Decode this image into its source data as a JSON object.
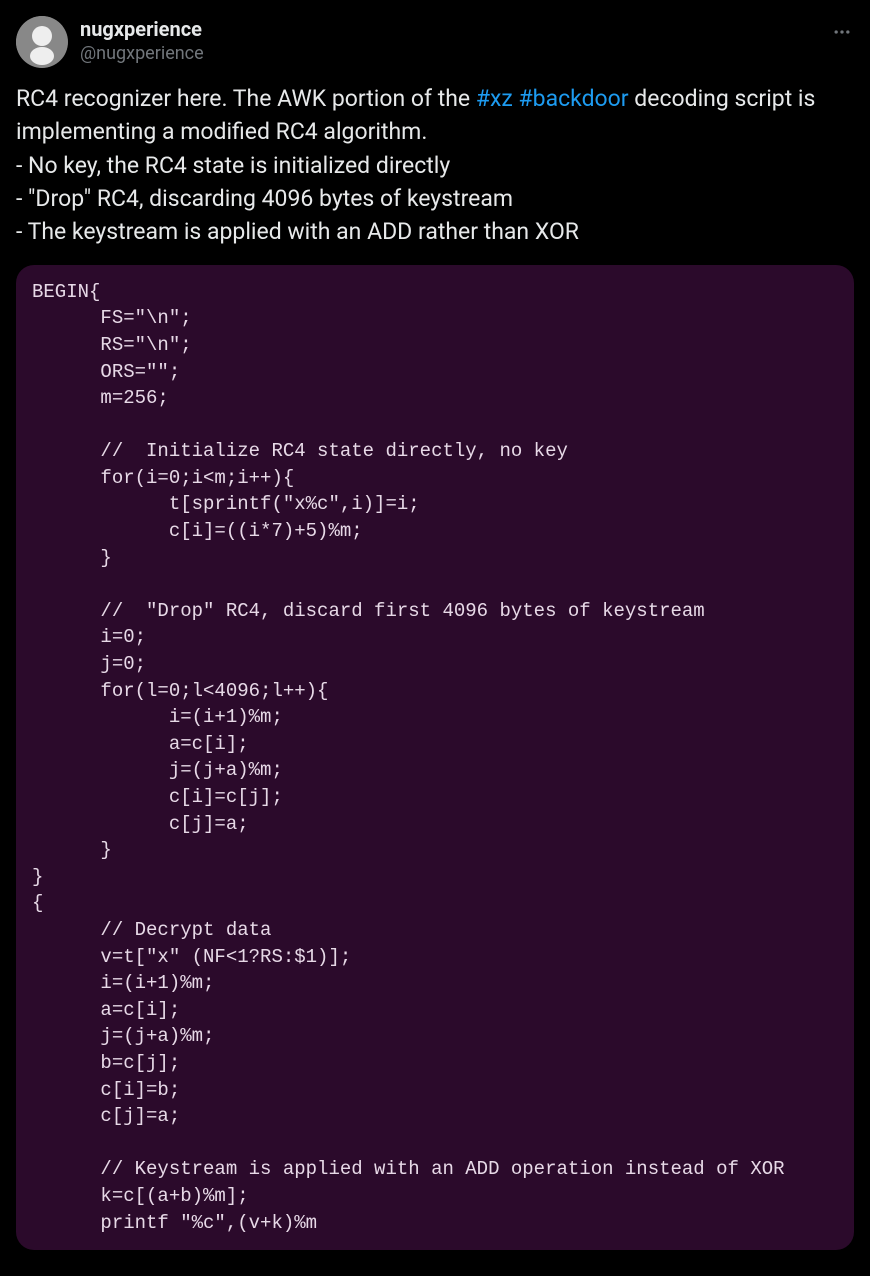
{
  "tweet": {
    "display_name": "nugxperience",
    "handle": "@nugxperience",
    "body": {
      "pre": "RC4 recognizer here. The AWK portion of the ",
      "hashtags": [
        "#xz",
        "#backdoor"
      ],
      "post": " decoding script is implementing a modified RC4 algorithm.\n- No key, the RC4 state is initialized directly\n- \"Drop\" RC4, discarding 4096 bytes of keystream\n- The keystream is applied with an ADD rather than XOR"
    },
    "code": "BEGIN{\n      FS=\"\\n\";\n      RS=\"\\n\";\n      ORS=\"\";\n      m=256;\n\n      //  Initialize RC4 state directly, no key\n      for(i=0;i<m;i++){\n            t[sprintf(\"x%c\",i)]=i;\n            c[i]=((i*7)+5)%m;\n      }\n\n      //  \"Drop\" RC4, discard first 4096 bytes of keystream\n      i=0;\n      j=0;\n      for(l=0;l<4096;l++){\n            i=(i+1)%m;\n            a=c[i];\n            j=(j+a)%m;\n            c[i]=c[j];\n            c[j]=a;\n      }\n}\n{\n      // Decrypt data\n      v=t[\"x\" (NF<1?RS:$1)];\n      i=(i+1)%m;\n      a=c[i];\n      j=(j+a)%m;\n      b=c[j];\n      c[i]=b;\n      c[j]=a;\n\n      // Keystream is applied with an ADD operation instead of XOR\n      k=c[(a+b)%m];\n      printf \"%c\",(v+k)%m"
  }
}
